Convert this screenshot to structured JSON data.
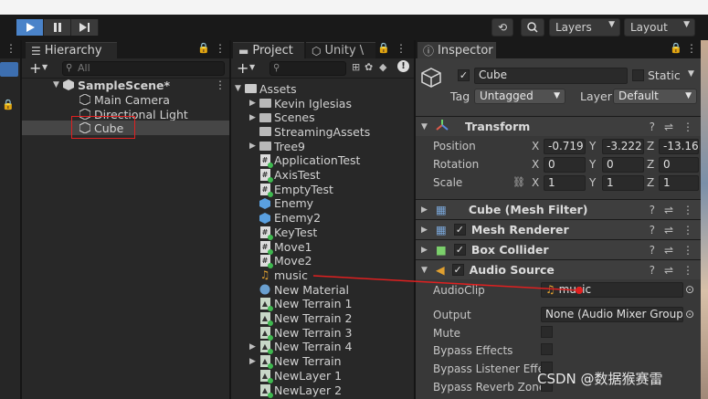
{
  "toolbar": {
    "layers_label": "Layers",
    "layout_label": "Layout"
  },
  "hierarchy": {
    "tab_label": "Hierarchy",
    "search_placeholder": "All",
    "scene_name": "SampleScene*",
    "objects": [
      "Main Camera",
      "Directional Light",
      "Cube"
    ],
    "selected": "Cube"
  },
  "project": {
    "tab_label": "Project",
    "tab2_label": "Unity \\",
    "root": "Assets",
    "items": [
      {
        "name": "Kevin Iglesias",
        "icon": "folder-icon",
        "foldable": true
      },
      {
        "name": "Scenes",
        "icon": "folder-icon",
        "foldable": true
      },
      {
        "name": "StreamingAssets",
        "icon": "folder-icon",
        "foldable": false
      },
      {
        "name": "Tree9",
        "icon": "folder-icon",
        "foldable": true
      },
      {
        "name": "ApplicationTest",
        "icon": "script-icon",
        "foldable": false
      },
      {
        "name": "AxisTest",
        "icon": "script-icon",
        "foldable": false
      },
      {
        "name": "EmptyTest",
        "icon": "script-icon",
        "foldable": false
      },
      {
        "name": "Enemy",
        "icon": "prefab-icon",
        "foldable": false
      },
      {
        "name": "Enemy2",
        "icon": "prefab-icon",
        "foldable": false
      },
      {
        "name": "KeyTest",
        "icon": "script-icon",
        "foldable": false
      },
      {
        "name": "Move1",
        "icon": "script-icon",
        "foldable": false
      },
      {
        "name": "Move2",
        "icon": "script-icon",
        "foldable": false
      },
      {
        "name": "music",
        "icon": "audio-icon",
        "foldable": false
      },
      {
        "name": "New Material",
        "icon": "material-icon",
        "foldable": false
      },
      {
        "name": "New Terrain 1",
        "icon": "terrain-icon",
        "foldable": false
      },
      {
        "name": "New Terrain 2",
        "icon": "terrain-icon",
        "foldable": false
      },
      {
        "name": "New Terrain 3",
        "icon": "terrain-icon",
        "foldable": false
      },
      {
        "name": "New Terrain 4",
        "icon": "terrain-icon",
        "foldable": true
      },
      {
        "name": "New Terrain",
        "icon": "terrain-icon",
        "foldable": true
      },
      {
        "name": "NewLayer 1",
        "icon": "terrain-icon",
        "foldable": false
      },
      {
        "name": "NewLayer 2",
        "icon": "terrain-icon",
        "foldable": false
      }
    ]
  },
  "inspector": {
    "tab_label": "Inspector",
    "object_name": "Cube",
    "static_label": "Static",
    "tag_label": "Tag",
    "tag_value": "Untagged",
    "layer_label": "Layer",
    "layer_value": "Default",
    "transform": {
      "title": "Transform",
      "position_label": "Position",
      "position": [
        "-0.719",
        "-3.222",
        "-13.16"
      ],
      "rotation_label": "Rotation",
      "rotation": [
        "0",
        "0",
        "0"
      ],
      "scale_label": "Scale",
      "scale": [
        "1",
        "1",
        "1"
      ]
    },
    "components": [
      "Cube (Mesh Filter)",
      "Mesh Renderer",
      "Box Collider",
      "Audio Source"
    ],
    "audio_source": {
      "audioclip_label": "AudioClip",
      "audioclip_value": "music",
      "output_label": "Output",
      "output_value": "None (Audio Mixer Group)",
      "props": [
        "Mute",
        "Bypass Effects",
        "Bypass Listener Effe",
        "Bypass Reverb Zone"
      ]
    }
  },
  "watermark": "CSDN @数据猴赛雷"
}
